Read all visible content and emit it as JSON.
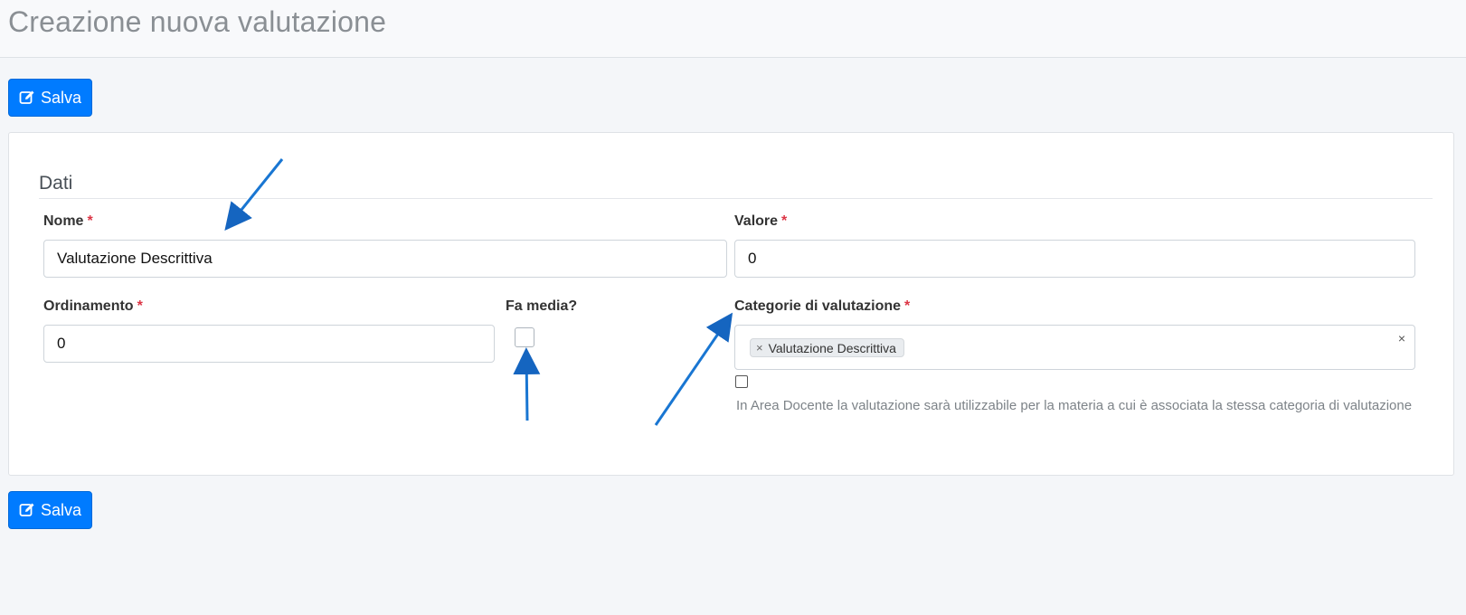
{
  "page": {
    "title": "Creazione nuova valutazione"
  },
  "toolbar": {
    "save_label": "Salva",
    "save_icon": "edit-icon"
  },
  "section": {
    "title": "Dati"
  },
  "fields": {
    "nome": {
      "label": "Nome",
      "required": "*",
      "value": "Valutazione Descrittiva"
    },
    "valore": {
      "label": "Valore",
      "required": "*",
      "value": "0"
    },
    "ordinamento": {
      "label": "Ordinamento",
      "required": "*",
      "value": "0"
    },
    "fa_media": {
      "label": "Fa media?"
    },
    "categorie": {
      "label": "Categorie di valutazione",
      "required": "*",
      "tags": [
        "Valutazione Descrittiva"
      ],
      "tag_remove": "×",
      "clear": "×",
      "help": "In Area Docente la valutazione sarà utilizzabile per la materia a cui è associata la stessa categoria di valutazione"
    }
  },
  "colors": {
    "primary": "#007bff",
    "required": "#dc3545",
    "annotation_arrow": "#1976d2"
  }
}
